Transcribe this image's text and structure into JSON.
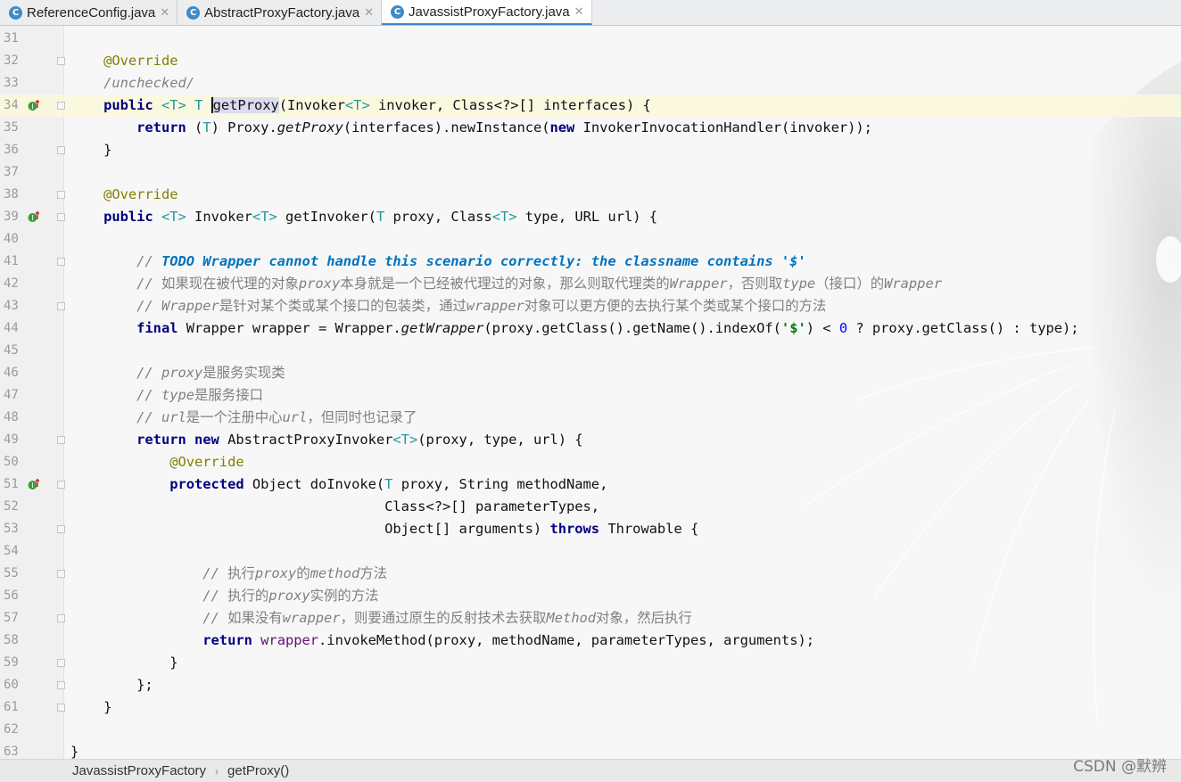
{
  "tabs": [
    {
      "label": "ReferenceConfig.java",
      "icon": "class-icon",
      "active": false
    },
    {
      "label": "AbstractProxyFactory.java",
      "icon": "class-icon",
      "active": false
    },
    {
      "label": "JavassistProxyFactory.java",
      "icon": "class-icon",
      "active": true
    }
  ],
  "tab_icon_letter": "C",
  "tab_close_glyph": "✕",
  "lines": [
    {
      "n": "31",
      "html": ""
    },
    {
      "n": "32",
      "html": "    <span class=\"ann\">@Override</span>"
    },
    {
      "n": "33",
      "html": "    <span class=\"cm\">/unchecked/</span>"
    },
    {
      "n": "34",
      "html": "    <span class=\"kw\">public</span> <span class=\"tp\">&lt;T&gt;</span> <span class=\"tp\">T</span> <span class=\"caret\"></span><span class=\"hl\">getProxy</span>(Invoker<span class=\"tp\">&lt;T&gt;</span> invoker, Class&lt;?&gt;[] interfaces) {",
      "current": true,
      "marker": true
    },
    {
      "n": "35",
      "html": "        <span class=\"kw\">return</span> (<span class=\"tp\">T</span>) Proxy.<span class=\"it\">getProxy</span>(interfaces).newInstance(<span class=\"kw\">new</span> InvokerInvocationHandler(invoker));"
    },
    {
      "n": "36",
      "html": "    }"
    },
    {
      "n": "37",
      "html": ""
    },
    {
      "n": "38",
      "html": "    <span class=\"ann\">@Override</span>"
    },
    {
      "n": "39",
      "html": "    <span class=\"kw\">public</span> <span class=\"tp\">&lt;T&gt;</span> Invoker<span class=\"tp\">&lt;T&gt;</span> getInvoker(<span class=\"tp\">T</span> proxy, Class<span class=\"tp\">&lt;T&gt;</span> type, URL url) {",
      "marker": true
    },
    {
      "n": "40",
      "html": ""
    },
    {
      "n": "41",
      "html": "        <span class=\"cm\">// </span><span class=\"todo\">TODO Wrapper cannot handle this scenario correctly: the classname contains '$'</span>"
    },
    {
      "n": "42",
      "html": "        <span class=\"cm\">// <span class=\"cn\">如果现在被代理的对象</span>proxy<span class=\"cn\">本身就是一个已经被代理过的对象，那么则取代理类的</span>Wrapper<span class=\"cn\">，否则取</span>type<span class=\"cn\">（接口）的</span>Wrapper</span>"
    },
    {
      "n": "43",
      "html": "        <span class=\"cm\">// Wrapper<span class=\"cn\">是针对某个类或某个接口的包装类，通过</span>wrapper<span class=\"cn\">对象可以更方便的去执行某个类或某个接口的方法</span></span>"
    },
    {
      "n": "44",
      "html": "        <span class=\"kw\">final</span> Wrapper wrapper = Wrapper.<span class=\"it\">getWrapper</span>(proxy.getClass().getName().indexOf(<span class=\"str\">'$'</span>) &lt; <span class=\"num\">0</span> ? proxy.getClass() : type);"
    },
    {
      "n": "45",
      "html": ""
    },
    {
      "n": "46",
      "html": "        <span class=\"cm\">// proxy<span class=\"cn\">是服务实现类</span></span>"
    },
    {
      "n": "47",
      "html": "        <span class=\"cm\">// type<span class=\"cn\">是服务接口</span></span>"
    },
    {
      "n": "48",
      "html": "        <span class=\"cm\">// url<span class=\"cn\">是一个注册中心</span>url<span class=\"cn\">，但同时也记录了</span></span>"
    },
    {
      "n": "49",
      "html": "        <span class=\"kw\">return new</span> AbstractProxyInvoker<span class=\"tp\">&lt;T&gt;</span>(proxy, type, url) {"
    },
    {
      "n": "50",
      "html": "            <span class=\"ann\">@Override</span>"
    },
    {
      "n": "51",
      "html": "            <span class=\"kw\">protected</span> Object doInvoke(<span class=\"tp\">T</span> proxy, String methodName,",
      "marker": true
    },
    {
      "n": "52",
      "html": "                                      Class&lt;?&gt;[] parameterTypes,"
    },
    {
      "n": "53",
      "html": "                                      Object[] arguments) <span class=\"kw\">throws</span> Throwable {"
    },
    {
      "n": "54",
      "html": ""
    },
    {
      "n": "55",
      "html": "                <span class=\"cm\">// <span class=\"cn\">执行</span>proxy<span class=\"cn\">的</span>method<span class=\"cn\">方法</span></span>"
    },
    {
      "n": "56",
      "html": "                <span class=\"cm\">// <span class=\"cn\">执行的</span>proxy<span class=\"cn\">实例的方法</span></span>"
    },
    {
      "n": "57",
      "html": "                <span class=\"cm\">// <span class=\"cn\">如果没有</span>wrapper<span class=\"cn\">，则要通过原生的反射技术去获取</span>Method<span class=\"cn\">对象，然后执行</span></span>"
    },
    {
      "n": "58",
      "html": "                <span class=\"kw\">return</span> <span class=\"fld\">wrapper</span>.invokeMethod(proxy, methodName, parameterTypes, arguments);"
    },
    {
      "n": "59",
      "html": "            }"
    },
    {
      "n": "60",
      "html": "        };"
    },
    {
      "n": "61",
      "html": "    }"
    },
    {
      "n": "62",
      "html": ""
    },
    {
      "n": "63",
      "html": "}"
    }
  ],
  "breadcrumb": {
    "class_name": "JavassistProxyFactory",
    "separator": "›",
    "method": "getProxy()"
  },
  "watermark": "CSDN @默辨",
  "colors": {
    "keyword": "#000080",
    "annotation": "#808000",
    "comment": "#808080",
    "todo": "#0073bf",
    "type_param": "#20999d"
  }
}
